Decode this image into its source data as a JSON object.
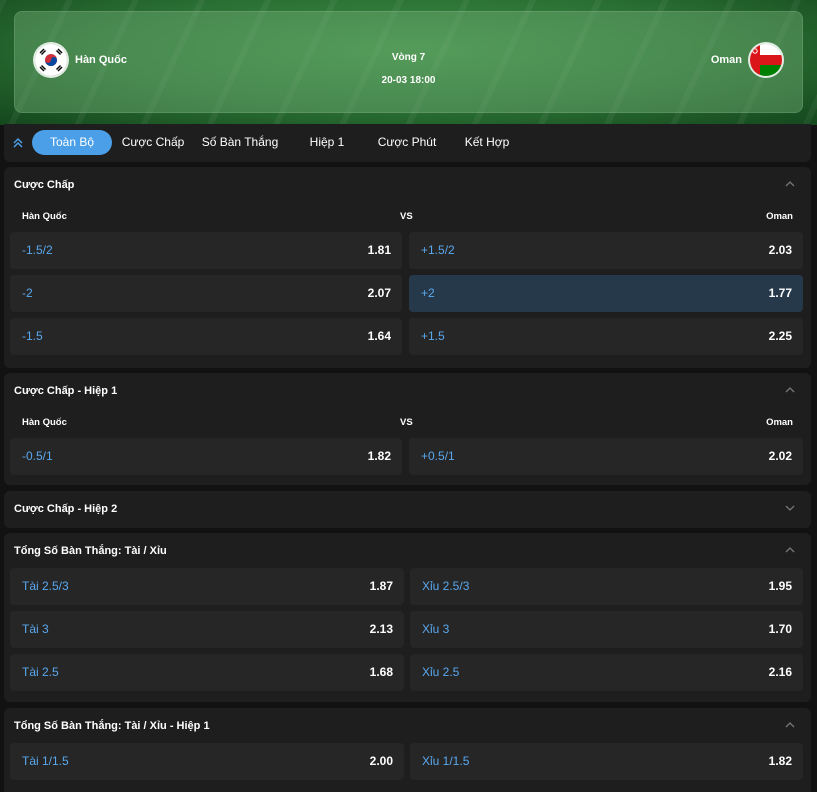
{
  "match": {
    "home": "Hàn Quốc",
    "away": "Oman",
    "round": "Vòng 7",
    "datetime": "20-03 18:00"
  },
  "tabs": [
    {
      "label": "Toàn Bộ",
      "active": true
    },
    {
      "label": "Cược Chấp"
    },
    {
      "label": "Số Bàn Thắng"
    },
    {
      "label": "Hiệp 1"
    },
    {
      "label": "Cược Phút"
    },
    {
      "label": "Kết Hợp"
    }
  ],
  "sections": [
    {
      "title": "Cược Chấp",
      "expanded": true,
      "head": {
        "home": "Hàn Quốc",
        "vs": "VS",
        "away": "Oman"
      },
      "rows": [
        {
          "left": {
            "label": "-1.5/2",
            "odd": "1.81"
          },
          "right": {
            "label": "+1.5/2",
            "odd": "2.03"
          }
        },
        {
          "left": {
            "label": "-2",
            "odd": "2.07"
          },
          "right": {
            "label": "+2",
            "odd": "1.77",
            "selected": true
          }
        },
        {
          "left": {
            "label": "-1.5",
            "odd": "1.64"
          },
          "right": {
            "label": "+1.5",
            "odd": "2.25"
          }
        }
      ]
    },
    {
      "title": "Cược Chấp - Hiệp 1",
      "expanded": true,
      "head": {
        "home": "Hàn Quốc",
        "vs": "VS",
        "away": "Oman"
      },
      "rows": [
        {
          "left": {
            "label": "-0.5/1",
            "odd": "1.82"
          },
          "right": {
            "label": "+0.5/1",
            "odd": "2.02"
          }
        }
      ]
    },
    {
      "title": "Cược Chấp - Hiệp 2",
      "expanded": false
    },
    {
      "title": "Tổng Số Bàn Thắng: Tài / Xỉu",
      "expanded": true,
      "rows": [
        {
          "left": {
            "label": "Tài 2.5/3",
            "odd": "1.87"
          },
          "right": {
            "label": "Xỉu 2.5/3",
            "odd": "1.95"
          }
        },
        {
          "left": {
            "label": "Tài 3",
            "odd": "2.13"
          },
          "right": {
            "label": "Xỉu 3",
            "odd": "1.70"
          }
        },
        {
          "left": {
            "label": "Tài 2.5",
            "odd": "1.68"
          },
          "right": {
            "label": "Xỉu 2.5",
            "odd": "2.16"
          }
        }
      ]
    },
    {
      "title": "Tổng Số Bàn Thắng: Tài / Xỉu - Hiệp 1",
      "expanded": true,
      "rows": [
        {
          "left": {
            "label": "Tài 1/1.5",
            "odd": "2.00"
          },
          "right": {
            "label": "Xỉu 1/1.5",
            "odd": "1.82"
          }
        }
      ]
    }
  ],
  "colors": {
    "accent": "#4a9fe8",
    "label_blue": "#5aa8ee",
    "panel": "#1e1e1e",
    "cell": "#262626",
    "cell_selected": "#26394b"
  }
}
